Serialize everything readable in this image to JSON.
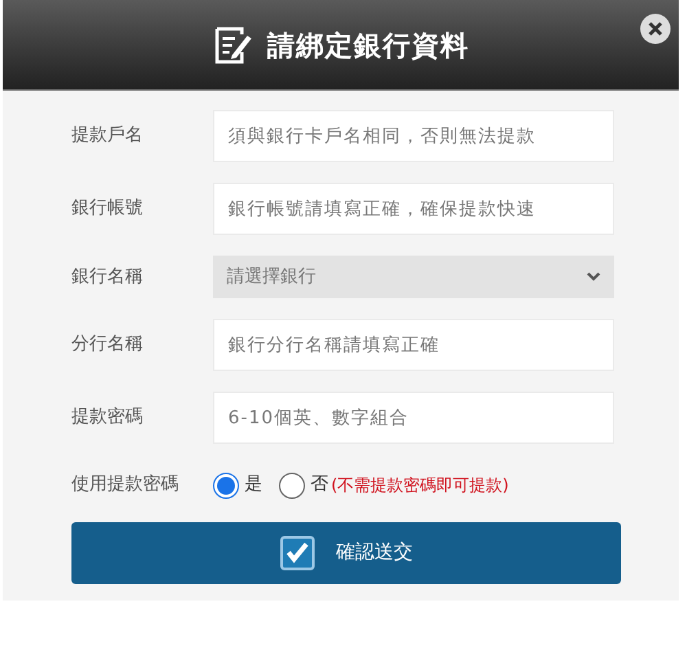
{
  "dialog": {
    "title": "請綁定銀行資料"
  },
  "fields": [
    {
      "kind": "text",
      "label": "提款戶名",
      "placeholder": "須與銀行卡戶名相同，否則無法提款"
    },
    {
      "kind": "text",
      "label": "銀行帳號",
      "placeholder": "銀行帳號請填寫正確，確保提款快速"
    },
    {
      "kind": "select",
      "label": "銀行名稱",
      "value": "請選擇銀行"
    },
    {
      "kind": "text",
      "label": "分行名稱",
      "placeholder": "銀行分行名稱請填寫正確"
    },
    {
      "kind": "text",
      "label": "提款密碼",
      "placeholder": "6-10個英、數字組合"
    }
  ],
  "use_password": {
    "label": "使用提款密碼",
    "options": [
      {
        "label": "是",
        "selected": true
      },
      {
        "label": "否",
        "selected": false
      }
    ],
    "note": "(不需提款密碼即可提款)"
  },
  "submit": {
    "label": "確認送交"
  }
}
